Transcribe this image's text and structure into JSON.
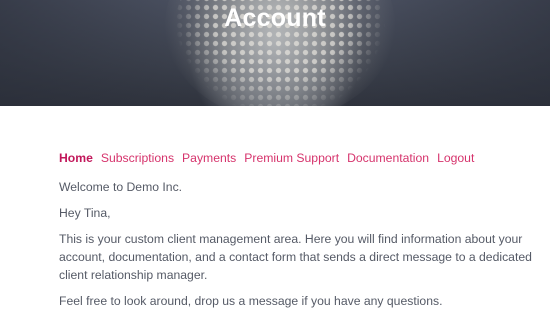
{
  "header": {
    "title": "Account"
  },
  "nav": {
    "items": [
      {
        "label": "Home",
        "active": true
      },
      {
        "label": "Subscriptions",
        "active": false
      },
      {
        "label": "Payments",
        "active": false
      },
      {
        "label": "Premium Support",
        "active": false
      },
      {
        "label": "Documentation",
        "active": false
      },
      {
        "label": "Logout",
        "active": false
      }
    ]
  },
  "main": {
    "welcome": "Welcome to Demo Inc.",
    "greeting": "Hey Tina,",
    "intro": "This is your custom client management area. Here you will find information about your account, documentation, and a contact form that sends a direct message to a dedicated client relationship manager.",
    "closing": "Feel free to look around, drop us a message if you have any questions."
  },
  "colors": {
    "accent": "#d6336c",
    "active": "#c2185b",
    "text": "#555a66"
  }
}
